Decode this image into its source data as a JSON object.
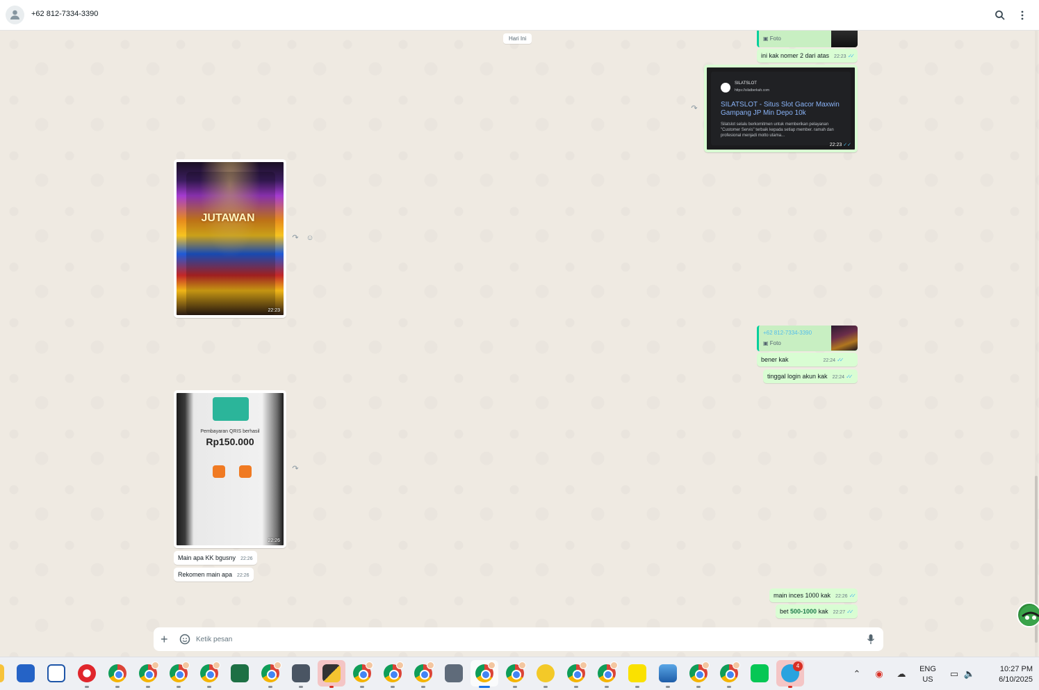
{
  "header": {
    "contact_name": "+62 812-7334-3390"
  },
  "chat": {
    "date_label": "Hari Ini",
    "messages": [
      {
        "kind": "quote",
        "direction": "out",
        "quote_label": "Foto"
      },
      {
        "kind": "text",
        "direction": "out",
        "text": "ini kak nomer 2 dari atas",
        "time": "22:23"
      },
      {
        "kind": "image",
        "direction": "out",
        "time": "22:23",
        "link_preview": {
          "site": "SILATSLOT",
          "url": "https://silatberkah.com",
          "title": "SILATSLOT - Situs Slot Gacor Maxwin Gampang JP Min Depo 10k",
          "desc": "Silatslot selalu berkomitmen untuk memberikan pelayanan \"Customer Servis\" terbaik kepada setiap member. ramah dan profesional menjadi motto utama..."
        }
      },
      {
        "kind": "image",
        "direction": "in",
        "time": "22:23",
        "image_text": "JUTAWAN"
      },
      {
        "kind": "quote",
        "direction": "out",
        "quote_name": "+62 812-7334-3390",
        "quote_label": "Foto"
      },
      {
        "kind": "text",
        "direction": "out",
        "text": "bener kak",
        "time": "22:24"
      },
      {
        "kind": "text",
        "direction": "out",
        "text": "tinggal login akun kak",
        "time": "22:24"
      },
      {
        "kind": "image",
        "direction": "in",
        "time": "22:26",
        "image_title": "Pembayaran QRIS berhasil",
        "image_amount": "Rp150.000"
      },
      {
        "kind": "text",
        "direction": "in",
        "text": "Main apa KK bgusny",
        "time": "22:26"
      },
      {
        "kind": "text",
        "direction": "in",
        "text": "Rekomen main apa",
        "time": "22:26"
      },
      {
        "kind": "text",
        "direction": "out",
        "text": "main inces 1000 kak",
        "time": "22:26"
      },
      {
        "kind": "text",
        "direction": "out",
        "text_prefix": "bet ",
        "text_highlight": "500-1000",
        "text_suffix": " kak",
        "time": "22:27"
      }
    ]
  },
  "composer": {
    "placeholder": "Ketik pesan"
  },
  "taskbar": {
    "language_line1": "ENG",
    "language_line2": "US",
    "clock_time": "10:27 PM",
    "clock_date": "6/10/2025",
    "telegram_badge": "4"
  },
  "colors": {
    "outgoing_bubble": "#d9fdd3",
    "incoming_bubble": "#ffffff",
    "chat_background": "#efeae2",
    "read_ticks": "#53bdeb"
  }
}
